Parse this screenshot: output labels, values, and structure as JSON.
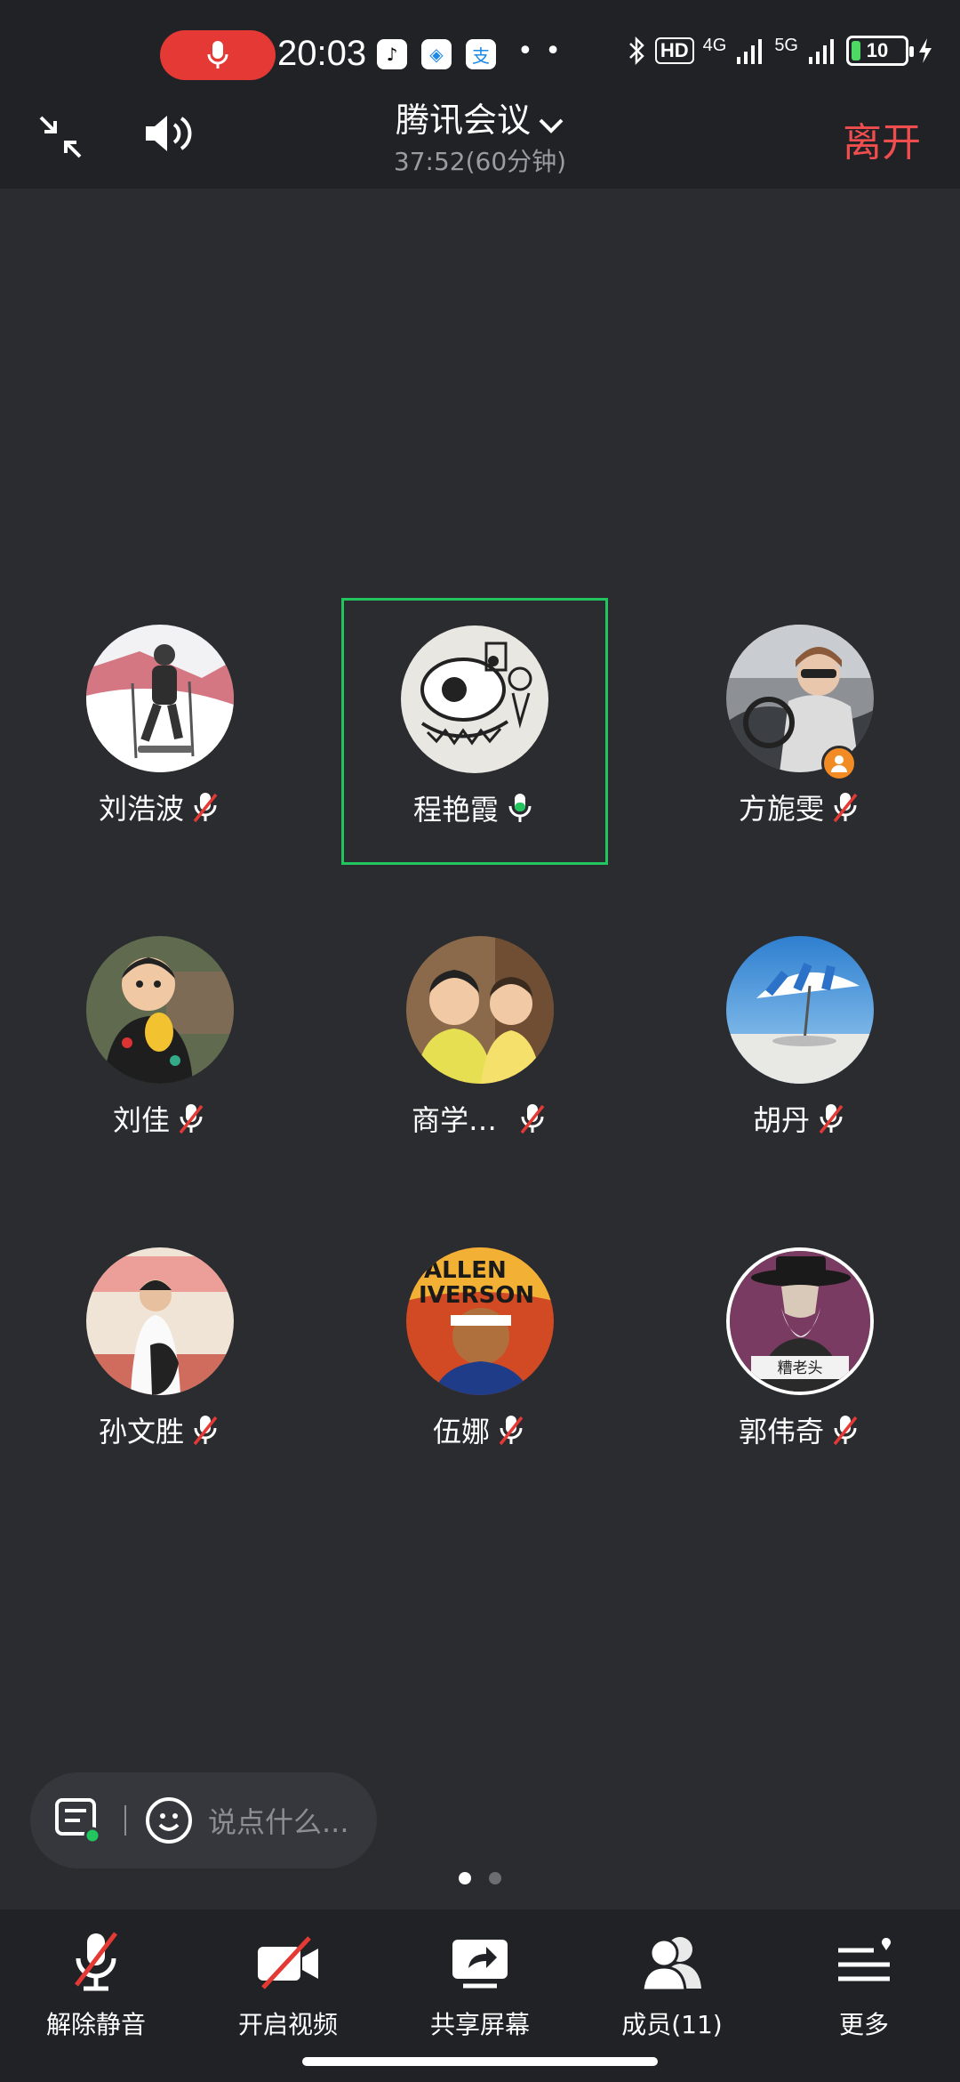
{
  "status_bar": {
    "time": "20:03",
    "hd_label": "HD",
    "net_4g": "4G",
    "net_5g": "5G",
    "battery": "10"
  },
  "header": {
    "title": "腾讯会议",
    "timer": "37:52(60分钟)",
    "leave_label": "离开"
  },
  "participants": [
    {
      "name": "刘浩波",
      "muted": true,
      "active": false
    },
    {
      "name": "程艳霞",
      "muted": false,
      "active": true
    },
    {
      "name": "方旎雯",
      "muted": true,
      "active": false,
      "host": true
    },
    {
      "name": "刘佳",
      "muted": true,
      "active": false
    },
    {
      "name": "商学…",
      "muted": true,
      "active": false
    },
    {
      "name": "胡丹",
      "muted": true,
      "active": false
    },
    {
      "name": "孙文胜",
      "muted": true,
      "active": false
    },
    {
      "name": "伍娜",
      "muted": true,
      "active": false
    },
    {
      "name": "郭伟奇",
      "muted": true,
      "active": false
    }
  ],
  "avatar_texts": {
    "guo_weiqi": "糟老头",
    "wu_na_line1": "ALLEN",
    "wu_na_line2": "IVERSON"
  },
  "chat": {
    "placeholder": "说点什么..."
  },
  "toolbar": {
    "unmute_label": "解除静音",
    "video_label": "开启视频",
    "share_label": "共享屏幕",
    "members_label": "成员(11)",
    "more_label": "更多"
  },
  "colors": {
    "background": "#2b2c30",
    "bar": "#212226",
    "leave": "#f04e4e",
    "active_border": "#22c55e",
    "record": "#e53935"
  }
}
